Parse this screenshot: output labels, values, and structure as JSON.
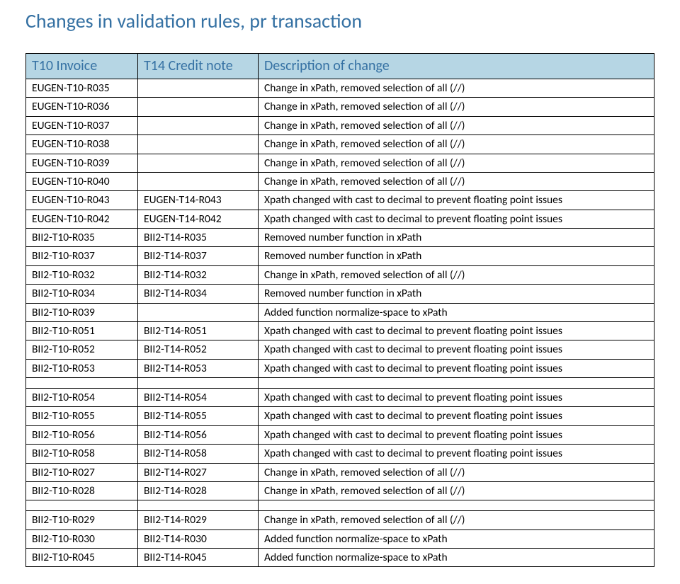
{
  "title": "Changes in validation rules, pr transaction",
  "table": {
    "headers": [
      "T10 Invoice",
      "T14 Credit note",
      "Description of change"
    ],
    "rows": [
      {
        "c1": "EUGEN-T10-R035",
        "c2": "",
        "c3": "Change in xPath, removed selection of all (//)"
      },
      {
        "c1": "EUGEN-T10-R036",
        "c2": "",
        "c3": "Change in xPath, removed selection of all (//)"
      },
      {
        "c1": "EUGEN-T10-R037",
        "c2": "",
        "c3": "Change in xPath, removed selection of all (//)"
      },
      {
        "c1": "EUGEN-T10-R038",
        "c2": "",
        "c3": "Change in xPath, removed selection of all (//)"
      },
      {
        "c1": "EUGEN-T10-R039",
        "c2": "",
        "c3": "Change in xPath, removed selection of all (//)"
      },
      {
        "c1": "EUGEN-T10-R040",
        "c2": "",
        "c3": "Change in xPath, removed selection of all (//)"
      },
      {
        "c1": "EUGEN-T10-R043",
        "c2": "EUGEN-T14-R043",
        "c3": "Xpath changed with cast to decimal to prevent floating point issues"
      },
      {
        "c1": "EUGEN-T10-R042",
        "c2": "EUGEN-T14-R042",
        "c3": "Xpath changed with cast to decimal to prevent floating point issues"
      },
      {
        "c1": "BII2-T10-R035",
        "c2": "BII2-T14-R035",
        "c3": "Removed number function in xPath"
      },
      {
        "c1": "BII2-T10-R037",
        "c2": "BII2-T14-R037",
        "c3": "Removed number function in xPath"
      },
      {
        "c1": "BII2-T10-R032",
        "c2": "BII2-T14-R032",
        "c3": "Change in xPath, removed selection of all (//)"
      },
      {
        "c1": "BII2-T10-R034",
        "c2": "BII2-T14-R034",
        "c3": "Removed number function in xPath"
      },
      {
        "c1": "BII2-T10-R039",
        "c2": "",
        "c3": "Added function normalize-space to xPath"
      },
      {
        "c1": "BII2-T10-R051",
        "c2": "BII2-T14-R051",
        "c3": "Xpath changed with cast to decimal to prevent floating point issues"
      },
      {
        "c1": "BII2-T10-R052",
        "c2": "BII2-T14-R052",
        "c3": "Xpath changed with cast to decimal to prevent floating point issues"
      },
      {
        "c1": "BII2-T10-R053",
        "c2": "BII2-T14-R053",
        "c3": "Xpath changed with cast to decimal to prevent floating point issues"
      },
      {
        "gap": true
      },
      {
        "c1": "BII2-T10-R054",
        "c2": "BII2-T14-R054",
        "c3": "Xpath changed with cast to decimal to prevent floating point issues"
      },
      {
        "c1": "BII2-T10-R055",
        "c2": "BII2-T14-R055",
        "c3": "Xpath changed with cast to decimal to prevent floating point issues"
      },
      {
        "c1": "BII2-T10-R056",
        "c2": "BII2-T14-R056",
        "c3": "Xpath changed with cast to decimal to prevent floating point issues"
      },
      {
        "c1": "BII2-T10-R058",
        "c2": "BII2-T14-R058",
        "c3": "Xpath changed with cast to decimal to prevent floating point issues"
      },
      {
        "c1": "BII2-T10-R027",
        "c2": "BII2-T14-R027",
        "c3": "Change in xPath, removed selection of all (//)"
      },
      {
        "c1": "BII2-T10-R028",
        "c2": "BII2-T14-R028",
        "c3": "Change in xPath, removed selection of all (//)"
      },
      {
        "gap": true
      },
      {
        "c1": "BII2-T10-R029",
        "c2": "BII2-T14-R029",
        "c3": "Change in xPath, removed selection of all (//)"
      },
      {
        "c1": "BII2-T10-R030",
        "c2": "BII2-T14-R030",
        "c3": "Added function normalize-space to xPath"
      },
      {
        "c1": "BII2-T10-R045",
        "c2": "BII2-T14-R045",
        "c3": "Added function normalize-space to xPath"
      }
    ]
  }
}
